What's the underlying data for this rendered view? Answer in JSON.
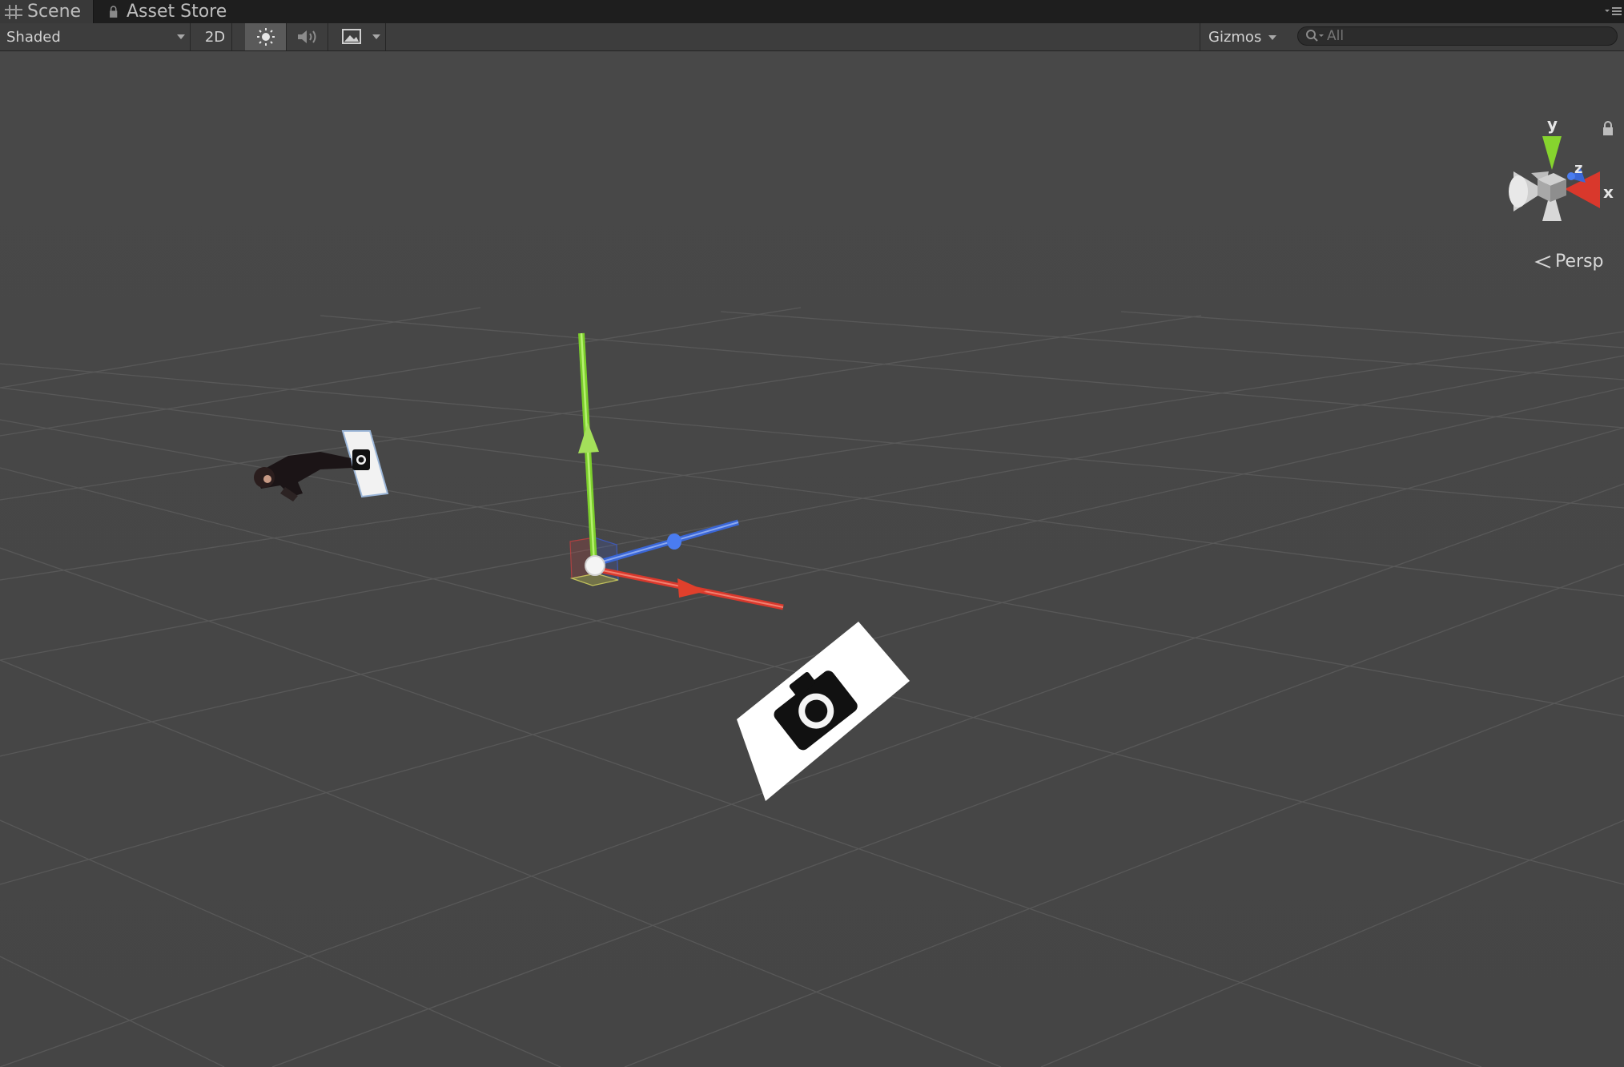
{
  "tabs": [
    {
      "label": "Scene",
      "icon": "grid-icon",
      "active": true
    },
    {
      "label": "Asset Store",
      "icon": "lock-icon",
      "active": false
    }
  ],
  "toolbar": {
    "shading_mode": "Shaded",
    "mode_2d_label": "2D",
    "lighting_icon": "sun-icon",
    "audio_icon": "speaker-icon",
    "effects_icon": "image-icon",
    "gizmos_label": "Gizmos",
    "search_placeholder": "All"
  },
  "scene_gizmo": {
    "axis_y": "y",
    "axis_z": "z",
    "axis_x": "x",
    "projection_label": "Persp"
  },
  "colors": {
    "x_axis": "#d9382c",
    "y_axis": "#7ccf2c",
    "z_axis": "#3a66d6",
    "viewport_bg": "#484848"
  }
}
